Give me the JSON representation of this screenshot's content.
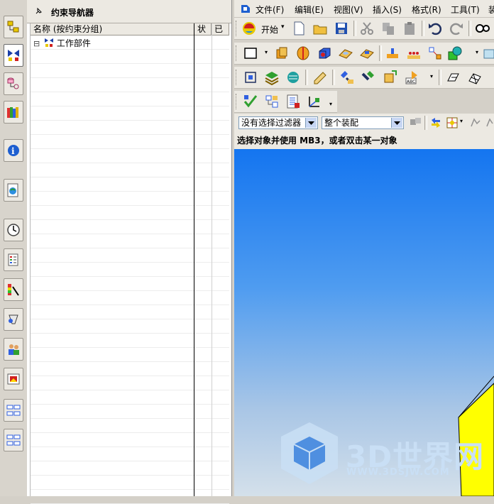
{
  "navigator": {
    "title": "约束导航器",
    "columns": {
      "name": "名称 (按约束分组)",
      "status": "状",
      "done": "已"
    },
    "tree": [
      {
        "expander": "⊟",
        "label": "工作部件"
      }
    ]
  },
  "resource_bar": {
    "icons": [
      "assembly-navigator-icon",
      "constraint-navigator-icon",
      "part-navigator-icon",
      "reuse-library-icon",
      "hd3d-tools-icon",
      "web-browser-icon",
      "history-icon",
      "process-studio-icon",
      "visualization-icon",
      "roles-icon",
      "teamcenter-icon",
      "system-materials-icon",
      "palette-icon",
      "palette-icon-2"
    ]
  },
  "menubar": {
    "items": [
      "文件(F)",
      "编辑(E)",
      "视图(V)",
      "插入(S)",
      "格式(R)",
      "工具(T)",
      "装"
    ]
  },
  "toolbar": {
    "start_label": "开始",
    "start_arrow": "▾"
  },
  "selection_bar": {
    "filter_value": "没有选择过滤器",
    "scope_value": "整个装配"
  },
  "status_line": "选择对象并使用 MB3，或者双击某一对象",
  "watermark": {
    "text": "3D世界网",
    "url": "WWW.3DSJW.COM"
  },
  "colors": {
    "viewport_top": "#1475f0",
    "viewport_bottom": "#d4e0ea",
    "part_yellow": "#ffff00"
  }
}
